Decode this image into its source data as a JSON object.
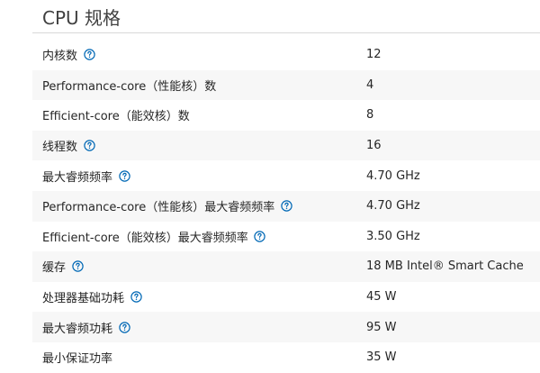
{
  "section": {
    "title": "CPU 规格"
  },
  "colors": {
    "accent": "#0068b5",
    "text": "#262626",
    "row_alt": "#f7f7f7"
  },
  "specs": [
    {
      "label": "内核数",
      "value": "12",
      "help": true,
      "help_icon": "question-circle-icon"
    },
    {
      "label": "Performance-core（性能核）数",
      "value": "4",
      "help": false
    },
    {
      "label": "Efficient-core（能效核）数",
      "value": "8",
      "help": false
    },
    {
      "label": "线程数",
      "value": "16",
      "help": true,
      "help_icon": "question-circle-icon"
    },
    {
      "label": "最大睿频频率",
      "value": "4.70 GHz",
      "help": true,
      "help_icon": "question-circle-icon"
    },
    {
      "label": "Performance-core（性能核）最大睿频频率",
      "value": "4.70 GHz",
      "help": true,
      "help_icon": "question-circle-icon"
    },
    {
      "label": "Efficient-core（能效核）最大睿频频率",
      "value": "3.50 GHz",
      "help": true,
      "help_icon": "question-circle-icon"
    },
    {
      "label": "缓存",
      "value": "18 MB Intel® Smart Cache",
      "help": true,
      "help_icon": "question-circle-icon"
    },
    {
      "label": "处理器基础功耗",
      "value": "45 W",
      "help": true,
      "help_icon": "question-circle-icon"
    },
    {
      "label": "最大睿频功耗",
      "value": "95 W",
      "help": true,
      "help_icon": "question-circle-icon"
    },
    {
      "label": "最小保证功率",
      "value": "35 W",
      "help": false
    }
  ]
}
